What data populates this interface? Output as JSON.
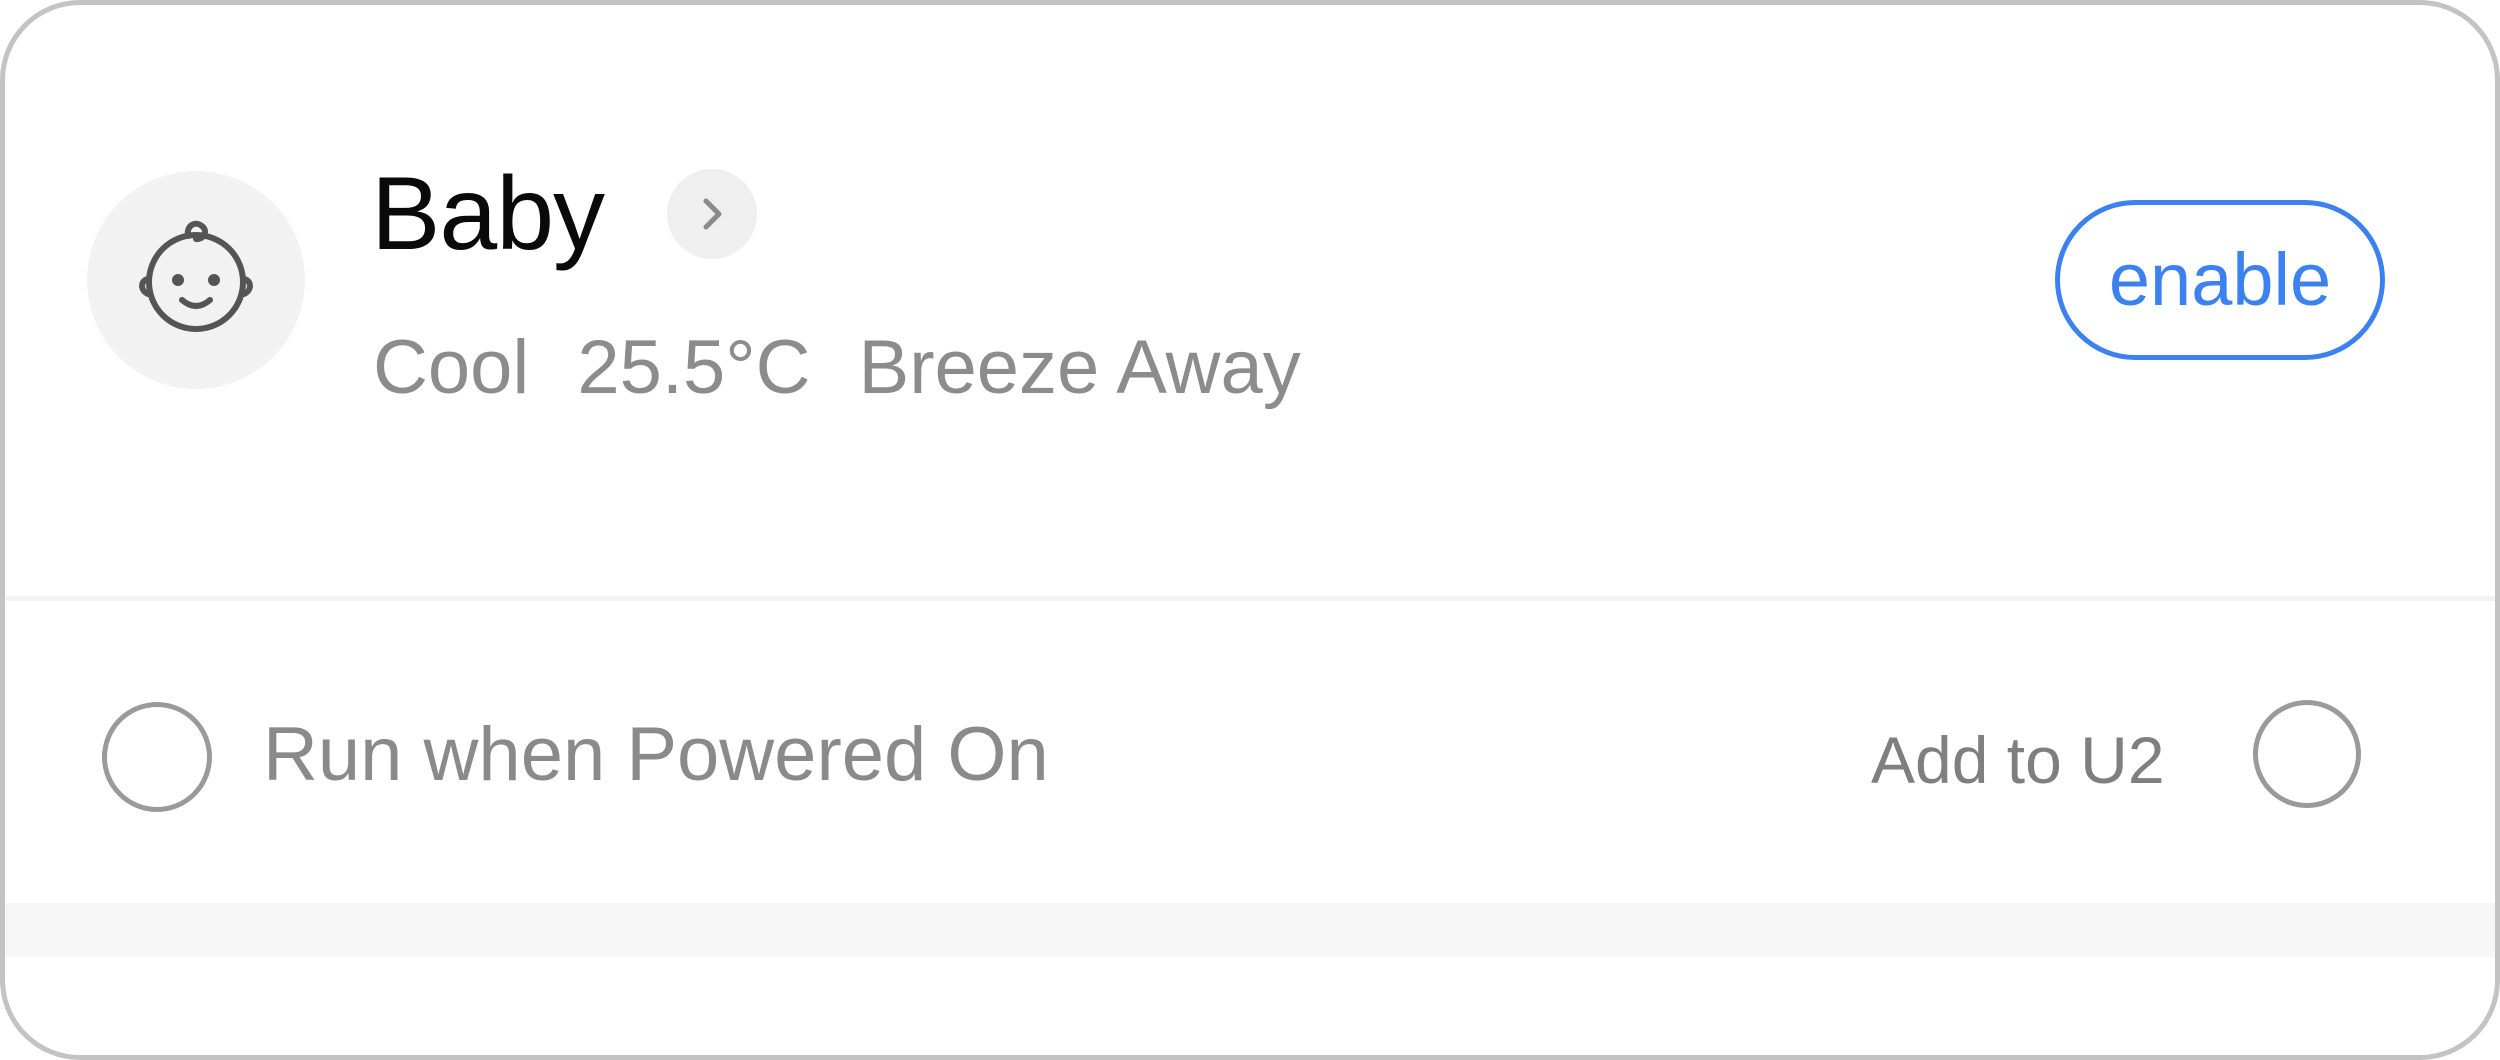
{
  "mode": {
    "icon": "baby-face-icon",
    "title": "Baby",
    "detail_icon": "chevron-right-icon",
    "details": [
      "Cool",
      "25.5°C",
      "Breeze Away"
    ],
    "enable_label": "enable"
  },
  "options": {
    "run_when_powered_on": {
      "label": "Run when Powered On",
      "checked": false
    },
    "add_to_u2": {
      "label": "Add to U2",
      "checked": false
    }
  },
  "colors": {
    "accent": "#3b82f0",
    "text_primary": "#0a0a0a",
    "text_secondary": "#8c8c8c",
    "icon_background": "#f2f2f2"
  }
}
